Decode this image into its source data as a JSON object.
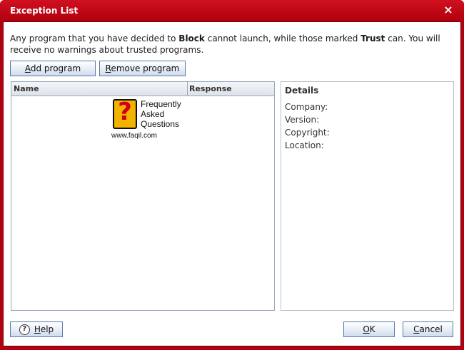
{
  "window": {
    "title": "Exception List",
    "close_glyph": "×"
  },
  "description": {
    "part1": "Any program that you have decided to ",
    "block_word": "Block",
    "part2": " cannot launch, while those marked ",
    "trust_word": "Trust",
    "part3": " can. You will receive no warnings about trusted programs."
  },
  "toolbar": {
    "add_mnemonic": "A",
    "add_rest": "dd program",
    "remove_mnemonic": "R",
    "remove_rest": "emove program"
  },
  "list": {
    "columns": [
      "Name",
      "Response"
    ],
    "rows": []
  },
  "watermark": {
    "glyph": "?",
    "lines": [
      "Frequently",
      "Asked",
      "Questions"
    ],
    "url": "www.faqil.com"
  },
  "details": {
    "title": "Details",
    "fields": [
      "Company:",
      "Version:",
      "Copyright:",
      "Location:"
    ]
  },
  "footer": {
    "help_glyph": "?",
    "help_mnemonic": "H",
    "help_rest": "elp",
    "ok_mnemonic": "O",
    "ok_rest": "K",
    "cancel_mnemonic": "C",
    "cancel_rest": "ancel"
  },
  "colors": {
    "title_bar": "#c20a18",
    "button_border": "#5a78a8"
  }
}
